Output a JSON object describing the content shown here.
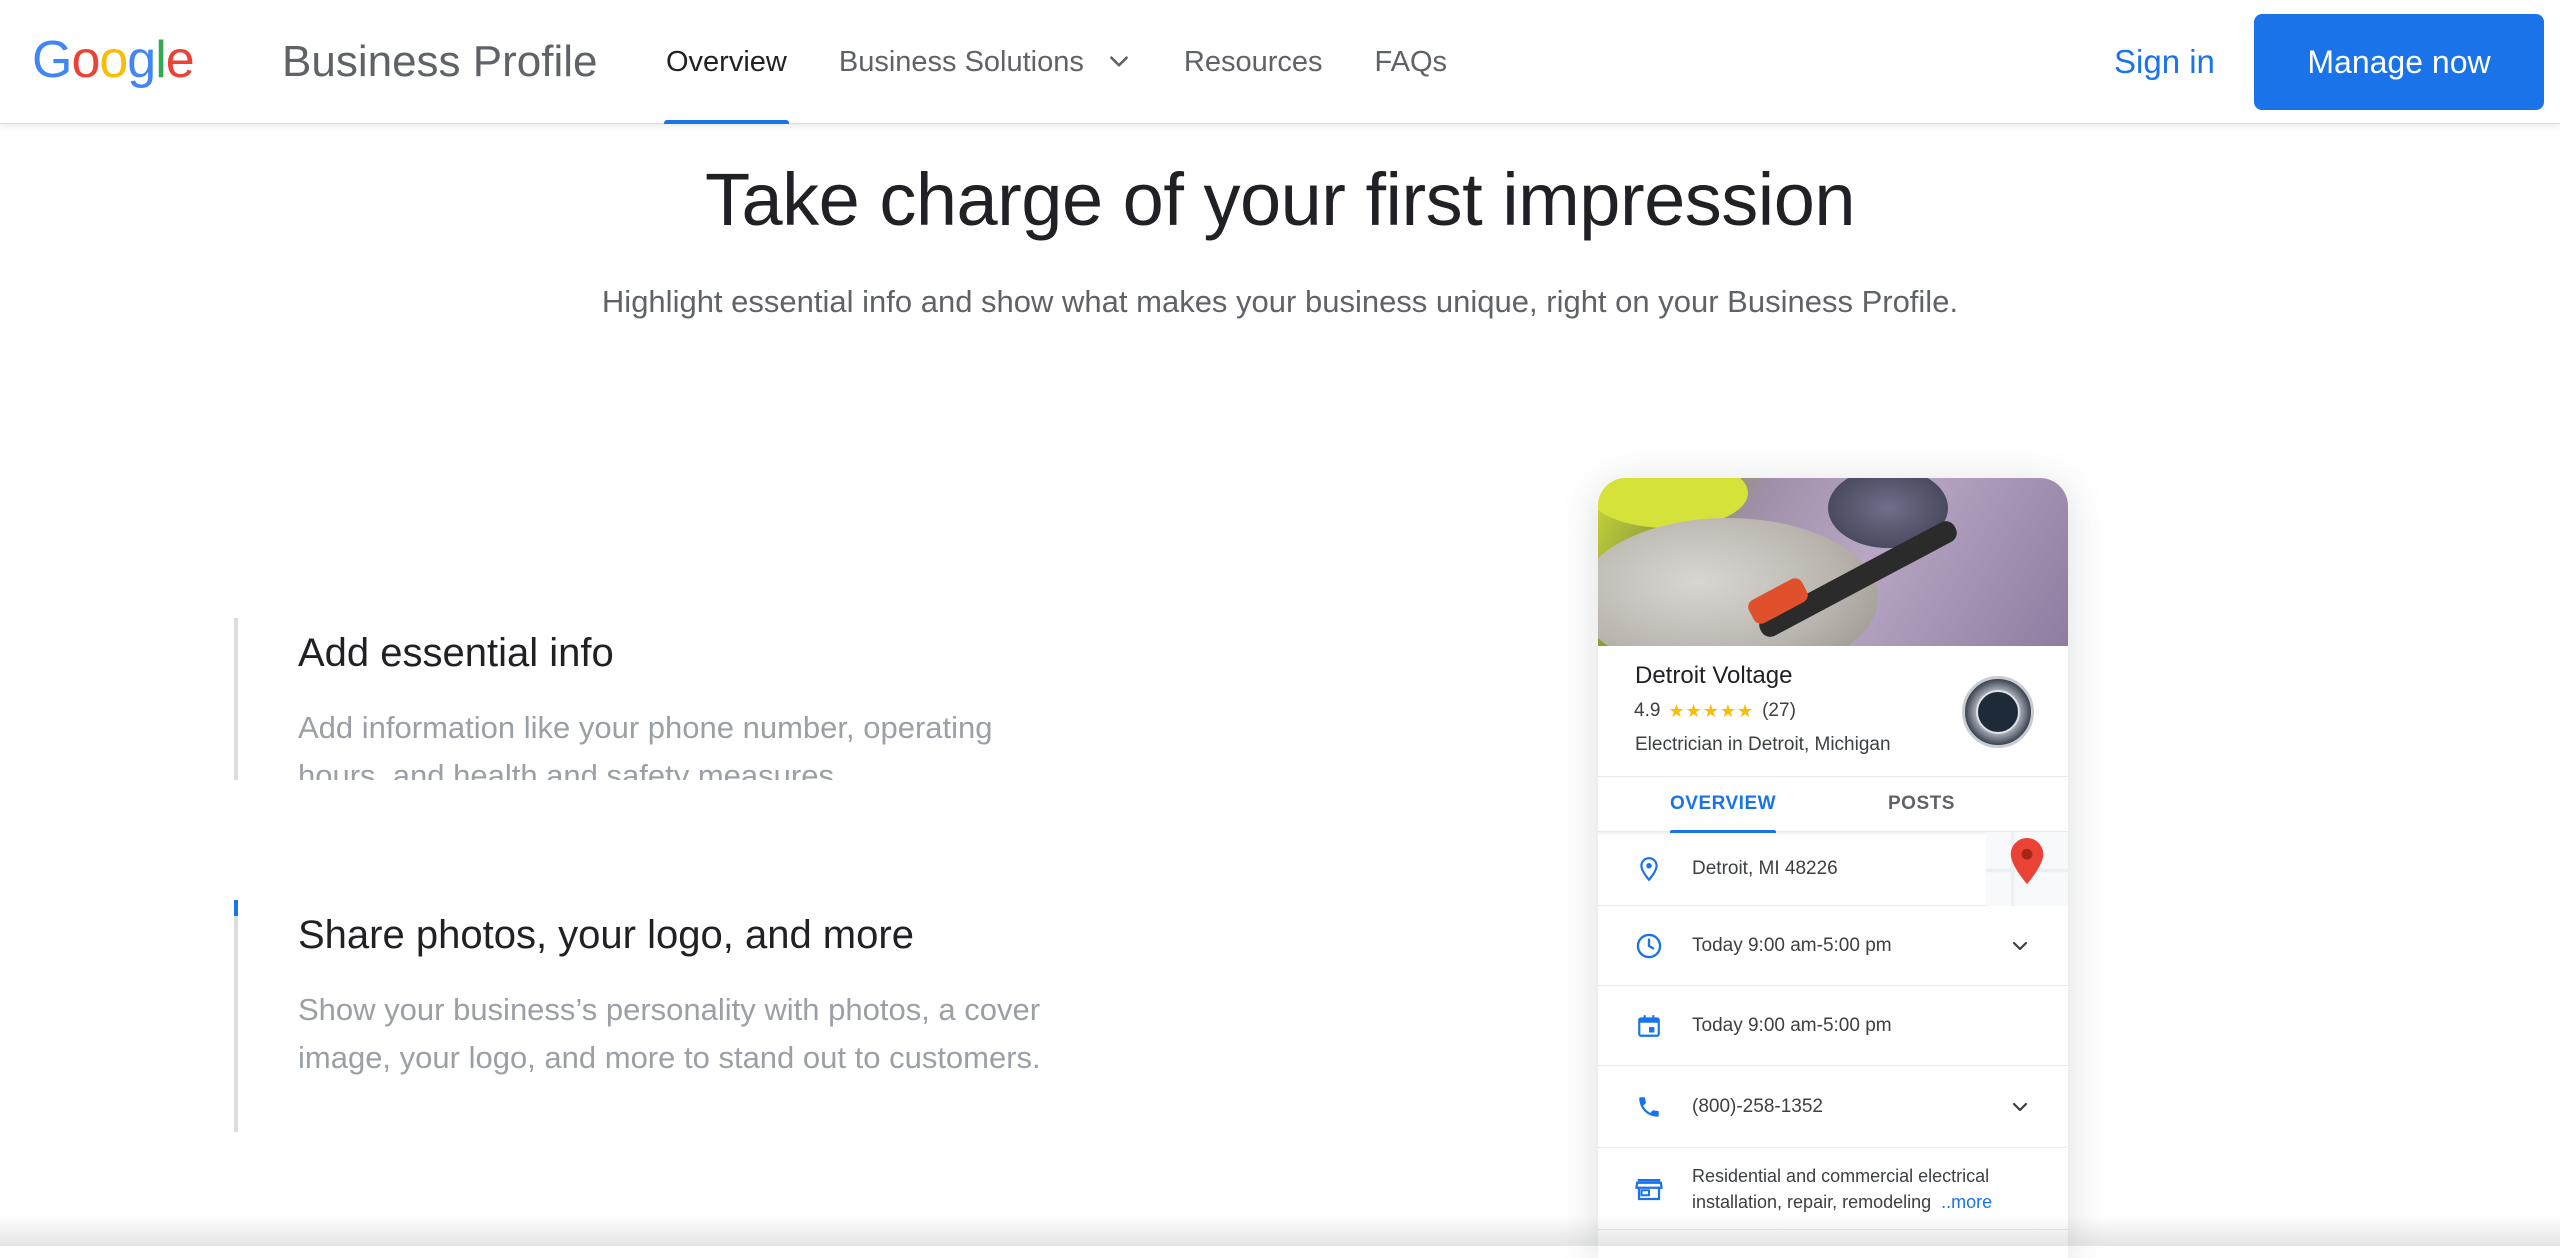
{
  "brand": {
    "logo_letters": [
      "G",
      "o",
      "o",
      "g",
      "l",
      "e"
    ],
    "logo_colors": [
      "#4285F4",
      "#EA4335",
      "#FBBC05",
      "#4285F4",
      "#34A853",
      "#EA4335"
    ],
    "product_name": "Business Profile"
  },
  "nav": {
    "items": [
      {
        "label": "Overview",
        "active": true
      },
      {
        "label": "Business Solutions",
        "has_dropdown": true
      },
      {
        "label": "Resources"
      },
      {
        "label": "FAQs"
      }
    ],
    "sign_in": "Sign in",
    "manage_now": "Manage now"
  },
  "hero": {
    "title": "Take charge of your first impression",
    "subtitle": "Highlight essential info and show what makes your business unique, right on your Business Profile."
  },
  "features": [
    {
      "title": "Add essential info",
      "body": "Add information like your phone number, operating hours, and health and safety measures."
    },
    {
      "title": "Share photos, your logo, and more",
      "body": "Show your business’s personality with photos, a cover image, your logo, and more to stand out to customers."
    }
  ],
  "profile_card": {
    "business_name": "Detroit Voltage",
    "rating": "4.9",
    "stars": "★★★★★",
    "star_count": 4.9,
    "review_count": "(27)",
    "category": "Electrician in Detroit, Michigan",
    "tabs": [
      "OVERVIEW",
      "POSTS"
    ],
    "address": "Detroit, MI 48226",
    "hours": "Today  9:00 am-5:00 pm",
    "calendar_hours": "Today  9:00 am-5:00 pm",
    "phone": "(800)-258-1352",
    "description_line1": "Residential and commercial electrical",
    "description_line2": "installation, repair, remodeling",
    "more_link": "..more",
    "icons": [
      "location-icon",
      "clock-icon",
      "calendar-icon",
      "phone-icon",
      "store-icon",
      "map-pin-icon"
    ],
    "accent_color": "#1a73e8",
    "star_color": "#fbbc04"
  },
  "colors": {
    "primary": "#1a73e8",
    "text_primary": "#202124",
    "text_secondary": "#5f6368",
    "text_muted": "#9aa0a6"
  }
}
